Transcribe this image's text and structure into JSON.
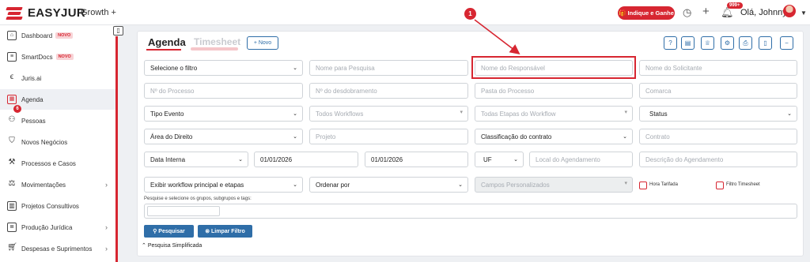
{
  "header": {
    "logo_text": "EASYJUR",
    "plan": "Growth +",
    "indique_label": "Indique e Ganhe",
    "notif_badge": "999+",
    "user_greeting": "Olá, Johnny",
    "accent": "#d72631"
  },
  "sidebar": {
    "items": [
      {
        "label": "Dashboard",
        "badge": "NOVO",
        "icon": "home-icon"
      },
      {
        "label": "SmartDocs",
        "badge": "NOVO",
        "icon": "document-icon"
      },
      {
        "label": "Juris.ai",
        "badge": "",
        "icon": "brain-icon"
      },
      {
        "label": "Agenda",
        "badge": "",
        "icon": "calendar-icon",
        "count": "6"
      },
      {
        "label": "Pessoas",
        "badge": "",
        "icon": "people-icon"
      },
      {
        "label": "Novos Negócios",
        "badge": "",
        "icon": "handshake-icon"
      },
      {
        "label": "Processos e Casos",
        "badge": "",
        "icon": "gavel-icon"
      },
      {
        "label": "Movimentações",
        "badge": "",
        "icon": "scale-icon"
      },
      {
        "label": "Projetos Consultivos",
        "badge": "",
        "icon": "building-icon"
      },
      {
        "label": "Produção Jurídica",
        "badge": "",
        "icon": "doc-icon"
      },
      {
        "label": "Despesas e Suprimentos",
        "badge": "",
        "icon": "cart-icon"
      }
    ]
  },
  "main": {
    "tabs": [
      "Agenda",
      "Timesheet"
    ],
    "novo_label": "+ Novo",
    "filters": {
      "row1": [
        "Selecione o filtro",
        "Nome para Pesquisa",
        "Nome do Responsável",
        "Nome do Solicitante"
      ],
      "row2": [
        "Nº do Processo",
        "Nº do desdobramento",
        "Pasta do Processo",
        "Comarca"
      ],
      "row3": [
        "Tipo Evento",
        "Todos Workflows",
        "Todas Etapas do Workflow",
        "Status"
      ],
      "row4": [
        "Área do Direito",
        "Projeto",
        "Classificação do contrato",
        "Contrato"
      ],
      "row5": [
        "Data Interna",
        "01/01/2026",
        "01/01/2026",
        "UF",
        "Local do Agendamento",
        "Descrição do Agendamento"
      ],
      "row6": [
        "Exibir workflow principal e etapas",
        "Ordenar por",
        "Campos Personalizados",
        "Hora Tarifada",
        "Filtro Timesheet"
      ]
    },
    "tags_label": "Pesquise e selecione os grupos, subgrupos e tags:",
    "search_button": "Pesquisar",
    "clear_button": "Limpar Filtro",
    "simple_search": "Pesquisa Simplificada",
    "callout_number": "1"
  }
}
